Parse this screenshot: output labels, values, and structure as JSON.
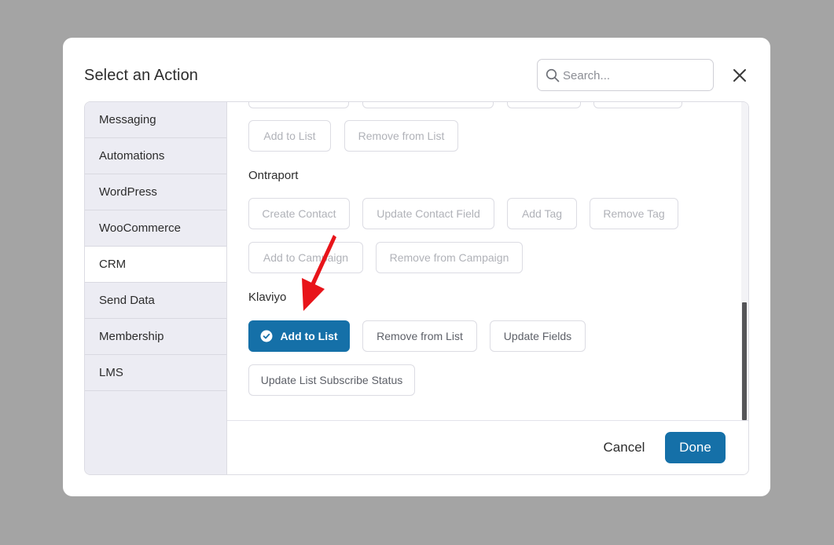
{
  "modal": {
    "title": "Select an Action",
    "search_placeholder": "Search..."
  },
  "sidebar": {
    "items": [
      {
        "label": "Messaging"
      },
      {
        "label": "Automations"
      },
      {
        "label": "WordPress"
      },
      {
        "label": "WooCommerce"
      },
      {
        "label": "CRM",
        "active": true
      },
      {
        "label": "Send Data"
      },
      {
        "label": "Membership"
      },
      {
        "label": "LMS"
      }
    ]
  },
  "sections": {
    "previous": {
      "actions": [
        "Add to List",
        "Remove from List"
      ]
    },
    "ontraport": {
      "title": "Ontraport",
      "actions": [
        "Create Contact",
        "Update Contact Field",
        "Add Tag",
        "Remove Tag",
        "Add to Campaign",
        "Remove from Campaign"
      ]
    },
    "klaviyo": {
      "title": "Klaviyo",
      "actions": [
        "Add to List",
        "Remove from List",
        "Update Fields",
        "Update List Subscribe Status"
      ],
      "selected": "Add to List"
    }
  },
  "footer": {
    "cancel_label": "Cancel",
    "done_label": "Done"
  },
  "colors": {
    "primary": "#1570a8",
    "annotation_arrow": "#e8141a",
    "sidebar_bg": "#ececf3"
  }
}
